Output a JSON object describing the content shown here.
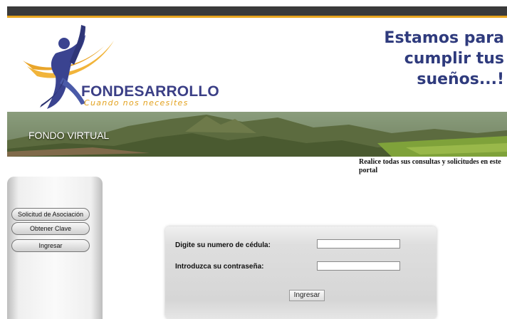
{
  "brand": {
    "name": "FONDESARROLLO",
    "tagline": "Cuando nos necesites"
  },
  "slogan": {
    "line1": "Estamos para",
    "line2": "cumplir tus",
    "line3": "sueños...!"
  },
  "banner": {
    "title": "FONDO VIRTUAL"
  },
  "portal_text": "Realice todas sus consultas y solicitudes en este portal",
  "sidebar": {
    "buttons": [
      {
        "label": "Solicitud de Asociación"
      },
      {
        "label": "Obtener Clave"
      },
      {
        "label": "Ingresar"
      }
    ]
  },
  "login": {
    "cedula_label": "Digite su numero de cédula:",
    "cedula_value": "",
    "password_label": "Introduzca su contraseña:",
    "password_value": "",
    "submit_label": "Ingresar"
  },
  "colors": {
    "topbar": "#3a3a3a",
    "accent": "#e8a51e",
    "brand_blue": "#3b3f86"
  }
}
